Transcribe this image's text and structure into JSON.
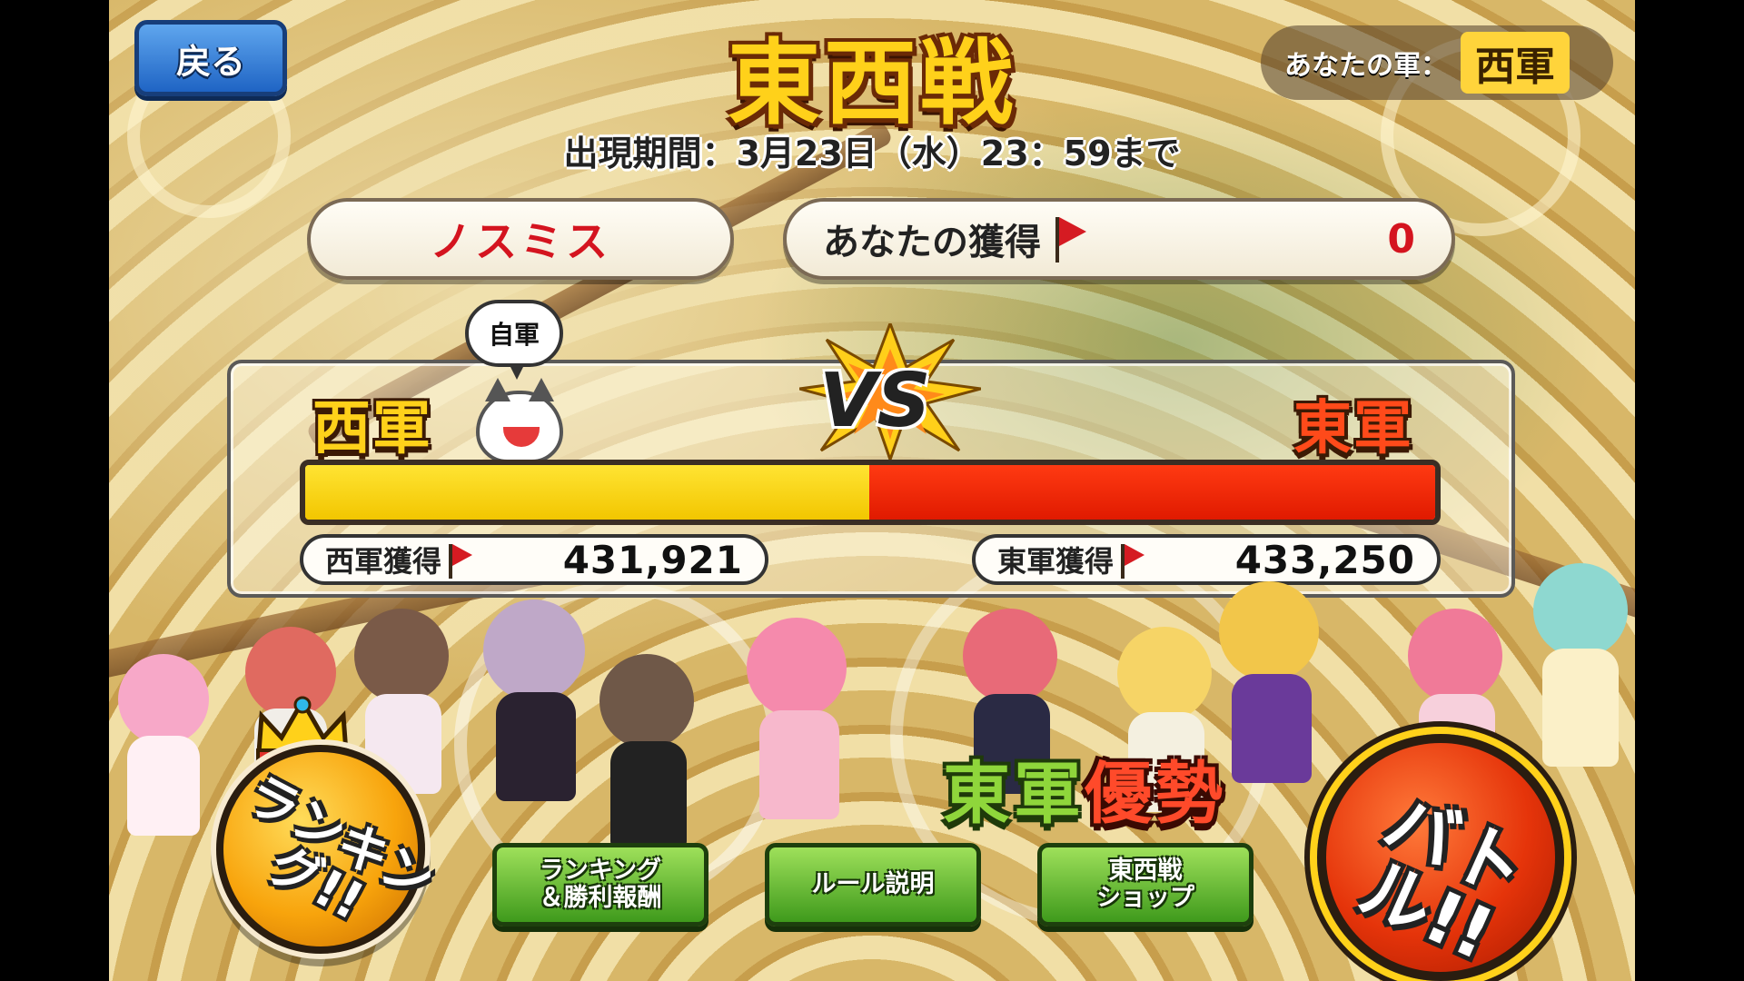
{
  "header": {
    "back_label": "戻る",
    "title": "東西戦",
    "period": "出現期間：3月23日（水）23：59まで",
    "your_army_label": "あなたの軍：",
    "your_army_value": "西軍"
  },
  "player": {
    "name": "ノスミス",
    "earned_label": "あなたの獲得",
    "earned_value": "0"
  },
  "versus": {
    "own_army_bubble": "自軍",
    "west_label": "西軍",
    "east_label": "東軍",
    "vs_text": "VS",
    "west_score_label": "西軍獲得",
    "west_score": "431,921",
    "east_score_label": "東軍獲得",
    "east_score": "433,250",
    "west_share": 0.4992,
    "west_color": "#ffe433",
    "east_color": "#ff2a00"
  },
  "status": {
    "advantage_part1": "東軍",
    "advantage_part2": "優勢"
  },
  "buttons": {
    "ranking": "ランキング!!",
    "ranking_rewards": "ランキング\n＆勝利報酬",
    "rules": "ルール説明",
    "shop": "東西戦\nショップ",
    "battle": "バトル!!"
  },
  "icons": [
    "flag-icon",
    "crown-icon",
    "cat-mascot-icon",
    "vs-burst-icon"
  ]
}
